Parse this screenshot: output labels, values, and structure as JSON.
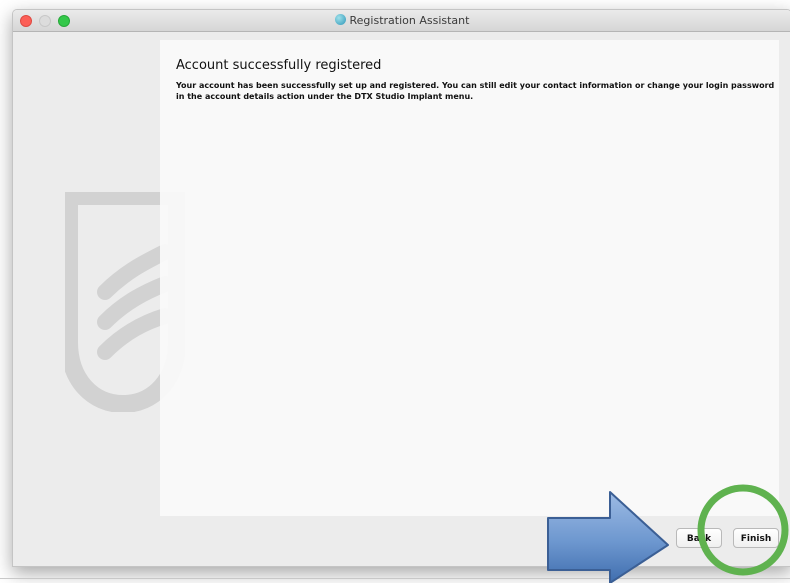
{
  "window": {
    "title": "Registration Assistant"
  },
  "content": {
    "heading": "Account successfully registered",
    "body": "Your account has been successfully set up and registered. You can still edit your contact information or change your login password in the account details action under the DTX Studio Implant menu."
  },
  "buttons": {
    "back_label": "Back",
    "finish_label": "Finish"
  },
  "annotations": {
    "arrow_color": "#6d97cf",
    "circle_color": "#5fb24f"
  }
}
